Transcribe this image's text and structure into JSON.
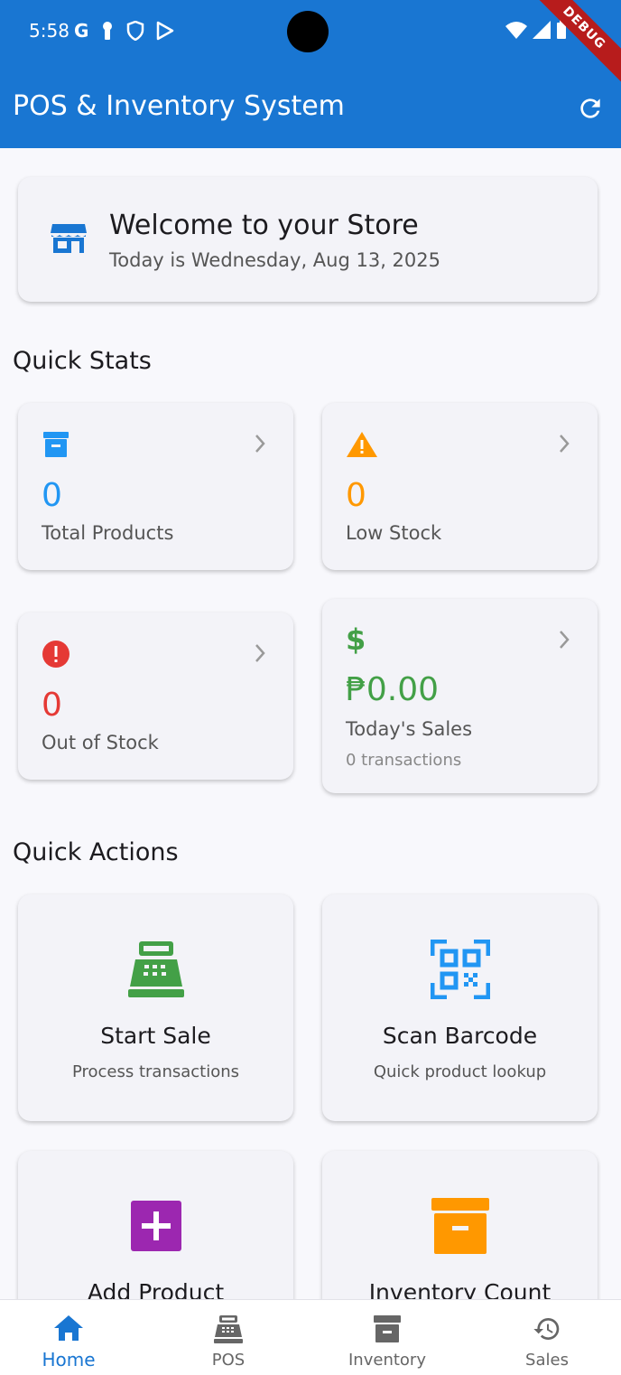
{
  "status_bar": {
    "time": "5:58",
    "icons": [
      "google-icon",
      "key-icon",
      "shield-icon",
      "play-icon"
    ],
    "debug_label": "DEBUG"
  },
  "app_bar": {
    "title": "POS & Inventory System",
    "action_icon": "refresh-icon"
  },
  "welcome": {
    "title": "Welcome to your Store",
    "date": "Today is Wednesday, Aug 13, 2025",
    "icon": "store-icon"
  },
  "quick_stats": {
    "heading": "Quick Stats",
    "items": [
      {
        "value": "0",
        "label": "Total Products",
        "icon": "archive-icon",
        "color": "#2196f3"
      },
      {
        "value": "0",
        "label": "Low Stock",
        "icon": "warning-icon",
        "color": "#ff9800"
      },
      {
        "value": "0",
        "label": "Out of Stock",
        "icon": "error-icon",
        "color": "#e53935"
      },
      {
        "value": "₱0.00",
        "label": "Today's Sales",
        "sub": "0 transactions",
        "icon": "dollar-icon",
        "color": "#43a047"
      }
    ]
  },
  "quick_actions": {
    "heading": "Quick Actions",
    "items": [
      {
        "title": "Start Sale",
        "subtitle": "Process transactions",
        "icon": "cash-register-icon",
        "color": "#43a047"
      },
      {
        "title": "Scan Barcode",
        "subtitle": "Quick product lookup",
        "icon": "qr-code-icon",
        "color": "#2196f3"
      },
      {
        "title": "Add Product",
        "icon": "add-box-icon",
        "color": "#9c27b0"
      },
      {
        "title": "Inventory Count",
        "icon": "inventory-icon",
        "color": "#ff9800"
      }
    ]
  },
  "bottom_nav": {
    "items": [
      {
        "label": "Home",
        "icon": "home-icon",
        "active": true
      },
      {
        "label": "POS",
        "icon": "pos-icon"
      },
      {
        "label": "Inventory",
        "icon": "inventory-icon"
      },
      {
        "label": "Sales",
        "icon": "history-icon"
      }
    ],
    "active_color": "#1976d2"
  }
}
